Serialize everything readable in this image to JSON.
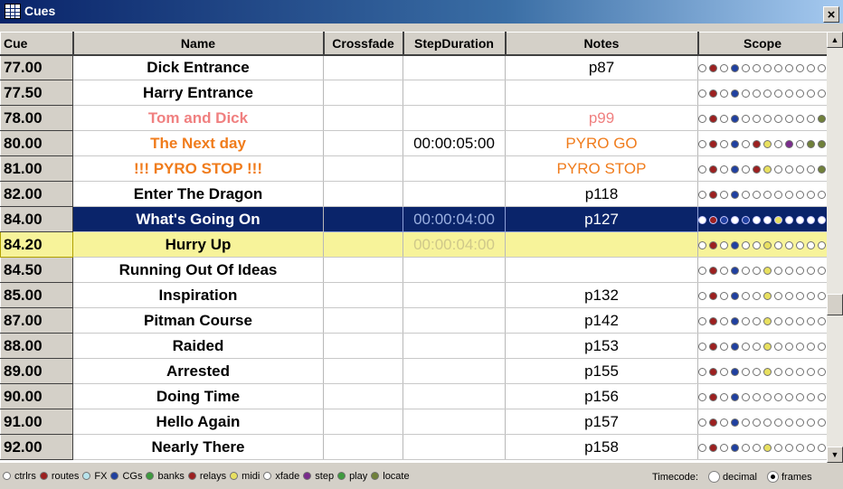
{
  "window": {
    "title": "Cues",
    "close_glyph": "×"
  },
  "columns": {
    "cue": "Cue",
    "name": "Name",
    "crossfade": "Crossfade",
    "step_duration": "StepDuration",
    "notes": "Notes",
    "scope": "Scope"
  },
  "colors": {
    "normal_name": "#000000",
    "pink_name": "#f08080",
    "orange_name": "#f07c1c",
    "selection": "#0a246a",
    "current": "#f7f39a",
    "dot_white": "#ffffff",
    "dot_red": "#9c2020",
    "dot_cyan": "#b8e4ec",
    "dot_blue": "#2040a0",
    "dot_olive": "#70803a",
    "dot_yellow": "#e8e060",
    "dot_purple": "#7a2c8c",
    "dot_green": "#3e9a3e"
  },
  "rows": [
    {
      "cue": "77.00",
      "name": "Dick Entrance",
      "crossfade": "",
      "step_duration": "",
      "notes": "p87",
      "name_color": "normal",
      "notes_color": "normal",
      "state": "",
      "scope": [
        "white",
        "red",
        "white",
        "blue",
        "white",
        "white",
        "white",
        "white",
        "white",
        "white",
        "white",
        "white"
      ]
    },
    {
      "cue": "77.50",
      "name": "Harry Entrance",
      "crossfade": "",
      "step_duration": "",
      "notes": "",
      "name_color": "normal",
      "notes_color": "normal",
      "state": "",
      "scope": [
        "white",
        "red",
        "white",
        "blue",
        "white",
        "white",
        "white",
        "white",
        "white",
        "white",
        "white",
        "white"
      ]
    },
    {
      "cue": "78.00",
      "name": "Tom and Dick",
      "crossfade": "",
      "step_duration": "",
      "notes": "p99",
      "name_color": "pink",
      "notes_color": "pink",
      "state": "",
      "scope": [
        "white",
        "red",
        "white",
        "blue",
        "white",
        "white",
        "white",
        "white",
        "white",
        "white",
        "white",
        "olive"
      ]
    },
    {
      "cue": "80.00",
      "name": "The Next day",
      "crossfade": "",
      "step_duration": "00:00:05:00",
      "notes": "PYRO GO",
      "name_color": "orange",
      "notes_color": "orange",
      "state": "",
      "scope": [
        "white",
        "red",
        "white",
        "blue",
        "white",
        "red",
        "yellow",
        "white",
        "purple",
        "white",
        "olive",
        "olive"
      ]
    },
    {
      "cue": "81.00",
      "name": "!!! PYRO STOP !!!",
      "crossfade": "",
      "step_duration": "",
      "notes": "PYRO STOP",
      "name_color": "orange",
      "notes_color": "orange",
      "state": "",
      "scope": [
        "white",
        "red",
        "white",
        "blue",
        "white",
        "red",
        "yellow",
        "white",
        "white",
        "white",
        "white",
        "olive"
      ]
    },
    {
      "cue": "82.00",
      "name": "Enter The Dragon",
      "crossfade": "",
      "step_duration": "",
      "notes": "p118",
      "name_color": "normal",
      "notes_color": "normal",
      "state": "",
      "scope": [
        "white",
        "red",
        "white",
        "blue",
        "white",
        "white",
        "white",
        "white",
        "white",
        "white",
        "white",
        "white"
      ]
    },
    {
      "cue": "84.00",
      "name": "What's Going On",
      "crossfade": "",
      "step_duration": "00:00:04:00",
      "notes": "p127",
      "name_color": "normal",
      "notes_color": "normal",
      "state": "selected",
      "scope": [
        "white",
        "red",
        "blue",
        "white",
        "blue",
        "white",
        "white",
        "yellow",
        "white",
        "white",
        "white",
        "white"
      ]
    },
    {
      "cue": "84.20",
      "name": "Hurry Up",
      "crossfade": "",
      "step_duration": "00:00:04:00",
      "notes": "",
      "name_color": "normal",
      "notes_color": "normal",
      "state": "current",
      "scope": [
        "white",
        "red",
        "white",
        "blue",
        "white",
        "white",
        "yellow",
        "white",
        "white",
        "white",
        "white",
        "white"
      ]
    },
    {
      "cue": "84.50",
      "name": "Running Out Of Ideas",
      "crossfade": "",
      "step_duration": "",
      "notes": "",
      "name_color": "normal",
      "notes_color": "normal",
      "state": "",
      "scope": [
        "white",
        "red",
        "white",
        "blue",
        "white",
        "white",
        "yellow",
        "white",
        "white",
        "white",
        "white",
        "white"
      ]
    },
    {
      "cue": "85.00",
      "name": "Inspiration",
      "crossfade": "",
      "step_duration": "",
      "notes": "p132",
      "name_color": "normal",
      "notes_color": "normal",
      "state": "",
      "scope": [
        "white",
        "red",
        "white",
        "blue",
        "white",
        "white",
        "yellow",
        "white",
        "white",
        "white",
        "white",
        "white"
      ]
    },
    {
      "cue": "87.00",
      "name": "Pitman Course",
      "crossfade": "",
      "step_duration": "",
      "notes": "p142",
      "name_color": "normal",
      "notes_color": "normal",
      "state": "",
      "scope": [
        "white",
        "red",
        "white",
        "blue",
        "white",
        "white",
        "yellow",
        "white",
        "white",
        "white",
        "white",
        "white"
      ]
    },
    {
      "cue": "88.00",
      "name": "Raided",
      "crossfade": "",
      "step_duration": "",
      "notes": "p153",
      "name_color": "normal",
      "notes_color": "normal",
      "state": "",
      "scope": [
        "white",
        "red",
        "white",
        "blue",
        "white",
        "white",
        "yellow",
        "white",
        "white",
        "white",
        "white",
        "white"
      ]
    },
    {
      "cue": "89.00",
      "name": "Arrested",
      "crossfade": "",
      "step_duration": "",
      "notes": "p155",
      "name_color": "normal",
      "notes_color": "normal",
      "state": "",
      "scope": [
        "white",
        "red",
        "white",
        "blue",
        "white",
        "white",
        "yellow",
        "white",
        "white",
        "white",
        "white",
        "white"
      ]
    },
    {
      "cue": "90.00",
      "name": "Doing Time",
      "crossfade": "",
      "step_duration": "",
      "notes": "p156",
      "name_color": "normal",
      "notes_color": "normal",
      "state": "",
      "scope": [
        "white",
        "red",
        "white",
        "blue",
        "white",
        "white",
        "white",
        "white",
        "white",
        "white",
        "white",
        "white"
      ]
    },
    {
      "cue": "91.00",
      "name": "Hello Again",
      "crossfade": "",
      "step_duration": "",
      "notes": "p157",
      "name_color": "normal",
      "notes_color": "normal",
      "state": "",
      "scope": [
        "white",
        "red",
        "white",
        "blue",
        "white",
        "white",
        "white",
        "white",
        "white",
        "white",
        "white",
        "white"
      ]
    },
    {
      "cue": "92.00",
      "name": "Nearly There",
      "crossfade": "",
      "step_duration": "",
      "notes": "p158",
      "name_color": "normal",
      "notes_color": "normal",
      "state": "",
      "scope": [
        "white",
        "red",
        "white",
        "blue",
        "white",
        "white",
        "yellow",
        "white",
        "white",
        "white",
        "white",
        "white"
      ]
    }
  ],
  "legend": [
    {
      "label": "ctrlrs",
      "color": "white"
    },
    {
      "label": "routes",
      "color": "red"
    },
    {
      "label": "FX",
      "color": "cyan"
    },
    {
      "label": "CGs",
      "color": "blue"
    },
    {
      "label": "banks",
      "color": "green"
    },
    {
      "label": "relays",
      "color": "red"
    },
    {
      "label": "midi",
      "color": "yellow"
    },
    {
      "label": "xfade",
      "color": "white"
    },
    {
      "label": "step",
      "color": "purple"
    },
    {
      "label": "play",
      "color": "green"
    },
    {
      "label": "locate",
      "color": "olive"
    }
  ],
  "timecode": {
    "label": "Timecode:",
    "options": [
      "decimal",
      "frames"
    ],
    "selected": "frames"
  },
  "scrollbar": {
    "up_glyph": "▲",
    "down_glyph": "▼"
  }
}
